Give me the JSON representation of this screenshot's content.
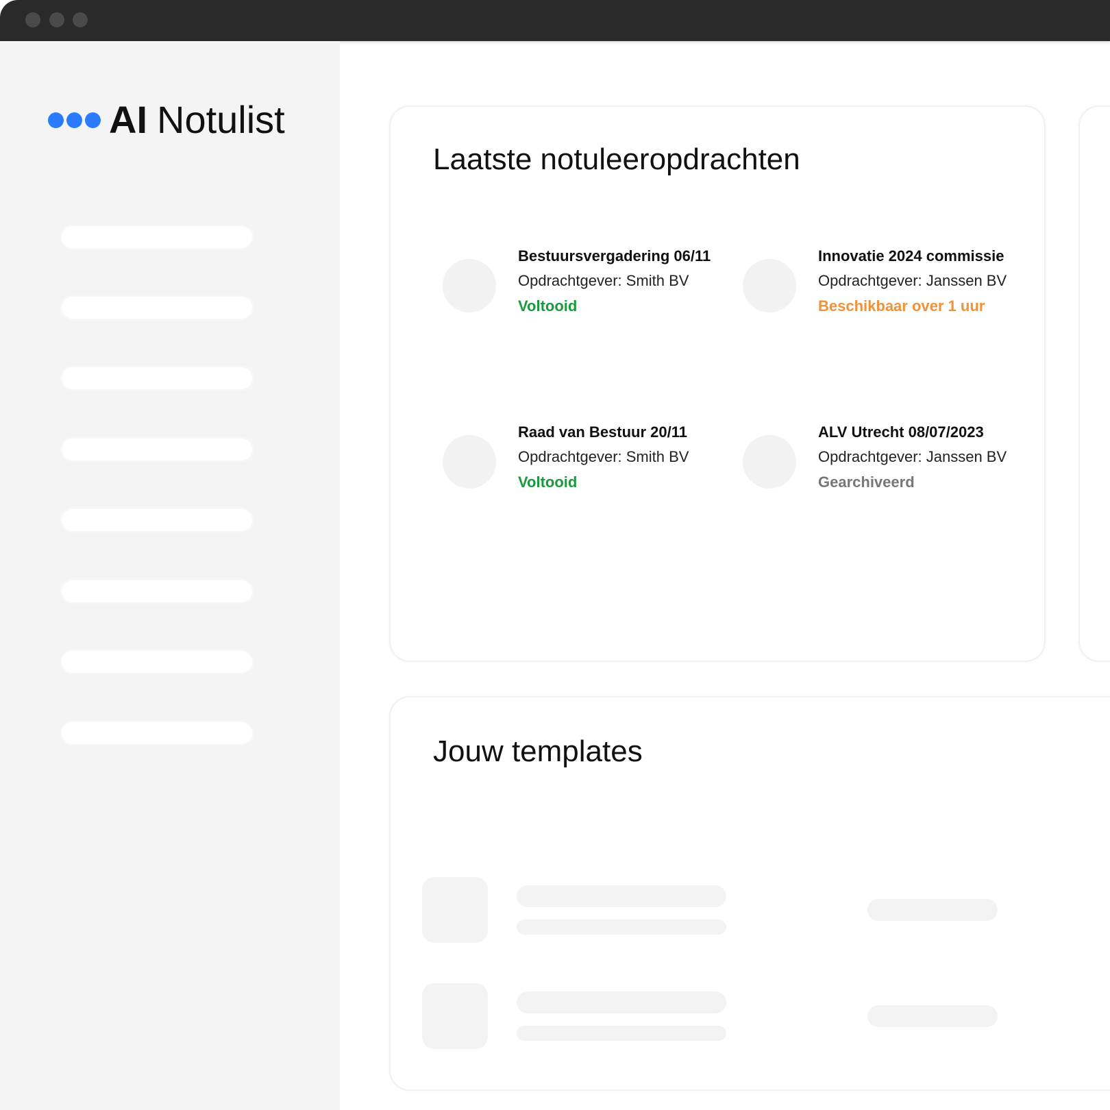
{
  "app": {
    "logo_bold": "AI",
    "logo_regular": "Notulist",
    "accent": "#2b7bff"
  },
  "recent": {
    "title": "Laatste notuleeropdrachten",
    "jobs": [
      {
        "title": "Bestuursvergadering 06/11",
        "client": "Opdrachtgever: Smith BV",
        "status": "Voltooid",
        "status_color": "#1a9a3c"
      },
      {
        "title": "Innovatie 2024 commissie",
        "client": "Opdrachtgever: Janssen BV",
        "status": "Beschikbaar over 1 uur",
        "status_color": "#f0923a"
      },
      {
        "title": "Raad van Bestuur 20/11",
        "client": "Opdrachtgever: Smith BV",
        "status": "Voltooid",
        "status_color": "#1a9a3c"
      },
      {
        "title": "ALV Utrecht 08/07/2023",
        "client": "Opdrachtgever: Janssen BV",
        "status": "Gearchiveerd",
        "status_color": "#777777"
      }
    ]
  },
  "templates": {
    "title": "Jouw templates"
  },
  "icons": {
    "window_controls": [
      "close-dot-icon",
      "minimize-dot-icon",
      "maximize-dot-icon"
    ],
    "logo": "three-dots-logo-icon"
  }
}
